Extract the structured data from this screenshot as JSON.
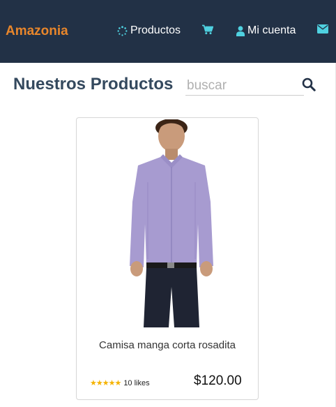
{
  "nav": {
    "brand": "Amazonia",
    "products_label": "Productos",
    "account_label": "Mi cuenta",
    "icons": {
      "products": "spinner-icon",
      "cart": "cart-icon",
      "account": "user-icon",
      "mail": "envelope-icon"
    }
  },
  "main": {
    "heading": "Nuestros Productos",
    "search_placeholder": "buscar"
  },
  "product": {
    "name": "Camisa manga corta rosadita",
    "rating": 5,
    "likes": "10 likes",
    "price": "$120.00"
  },
  "colors": {
    "navbar_bg": "#223146",
    "brand": "#e8862b",
    "nav_icon": "#4fd1e0",
    "heading": "#34495e",
    "stars": "#f5b301"
  }
}
